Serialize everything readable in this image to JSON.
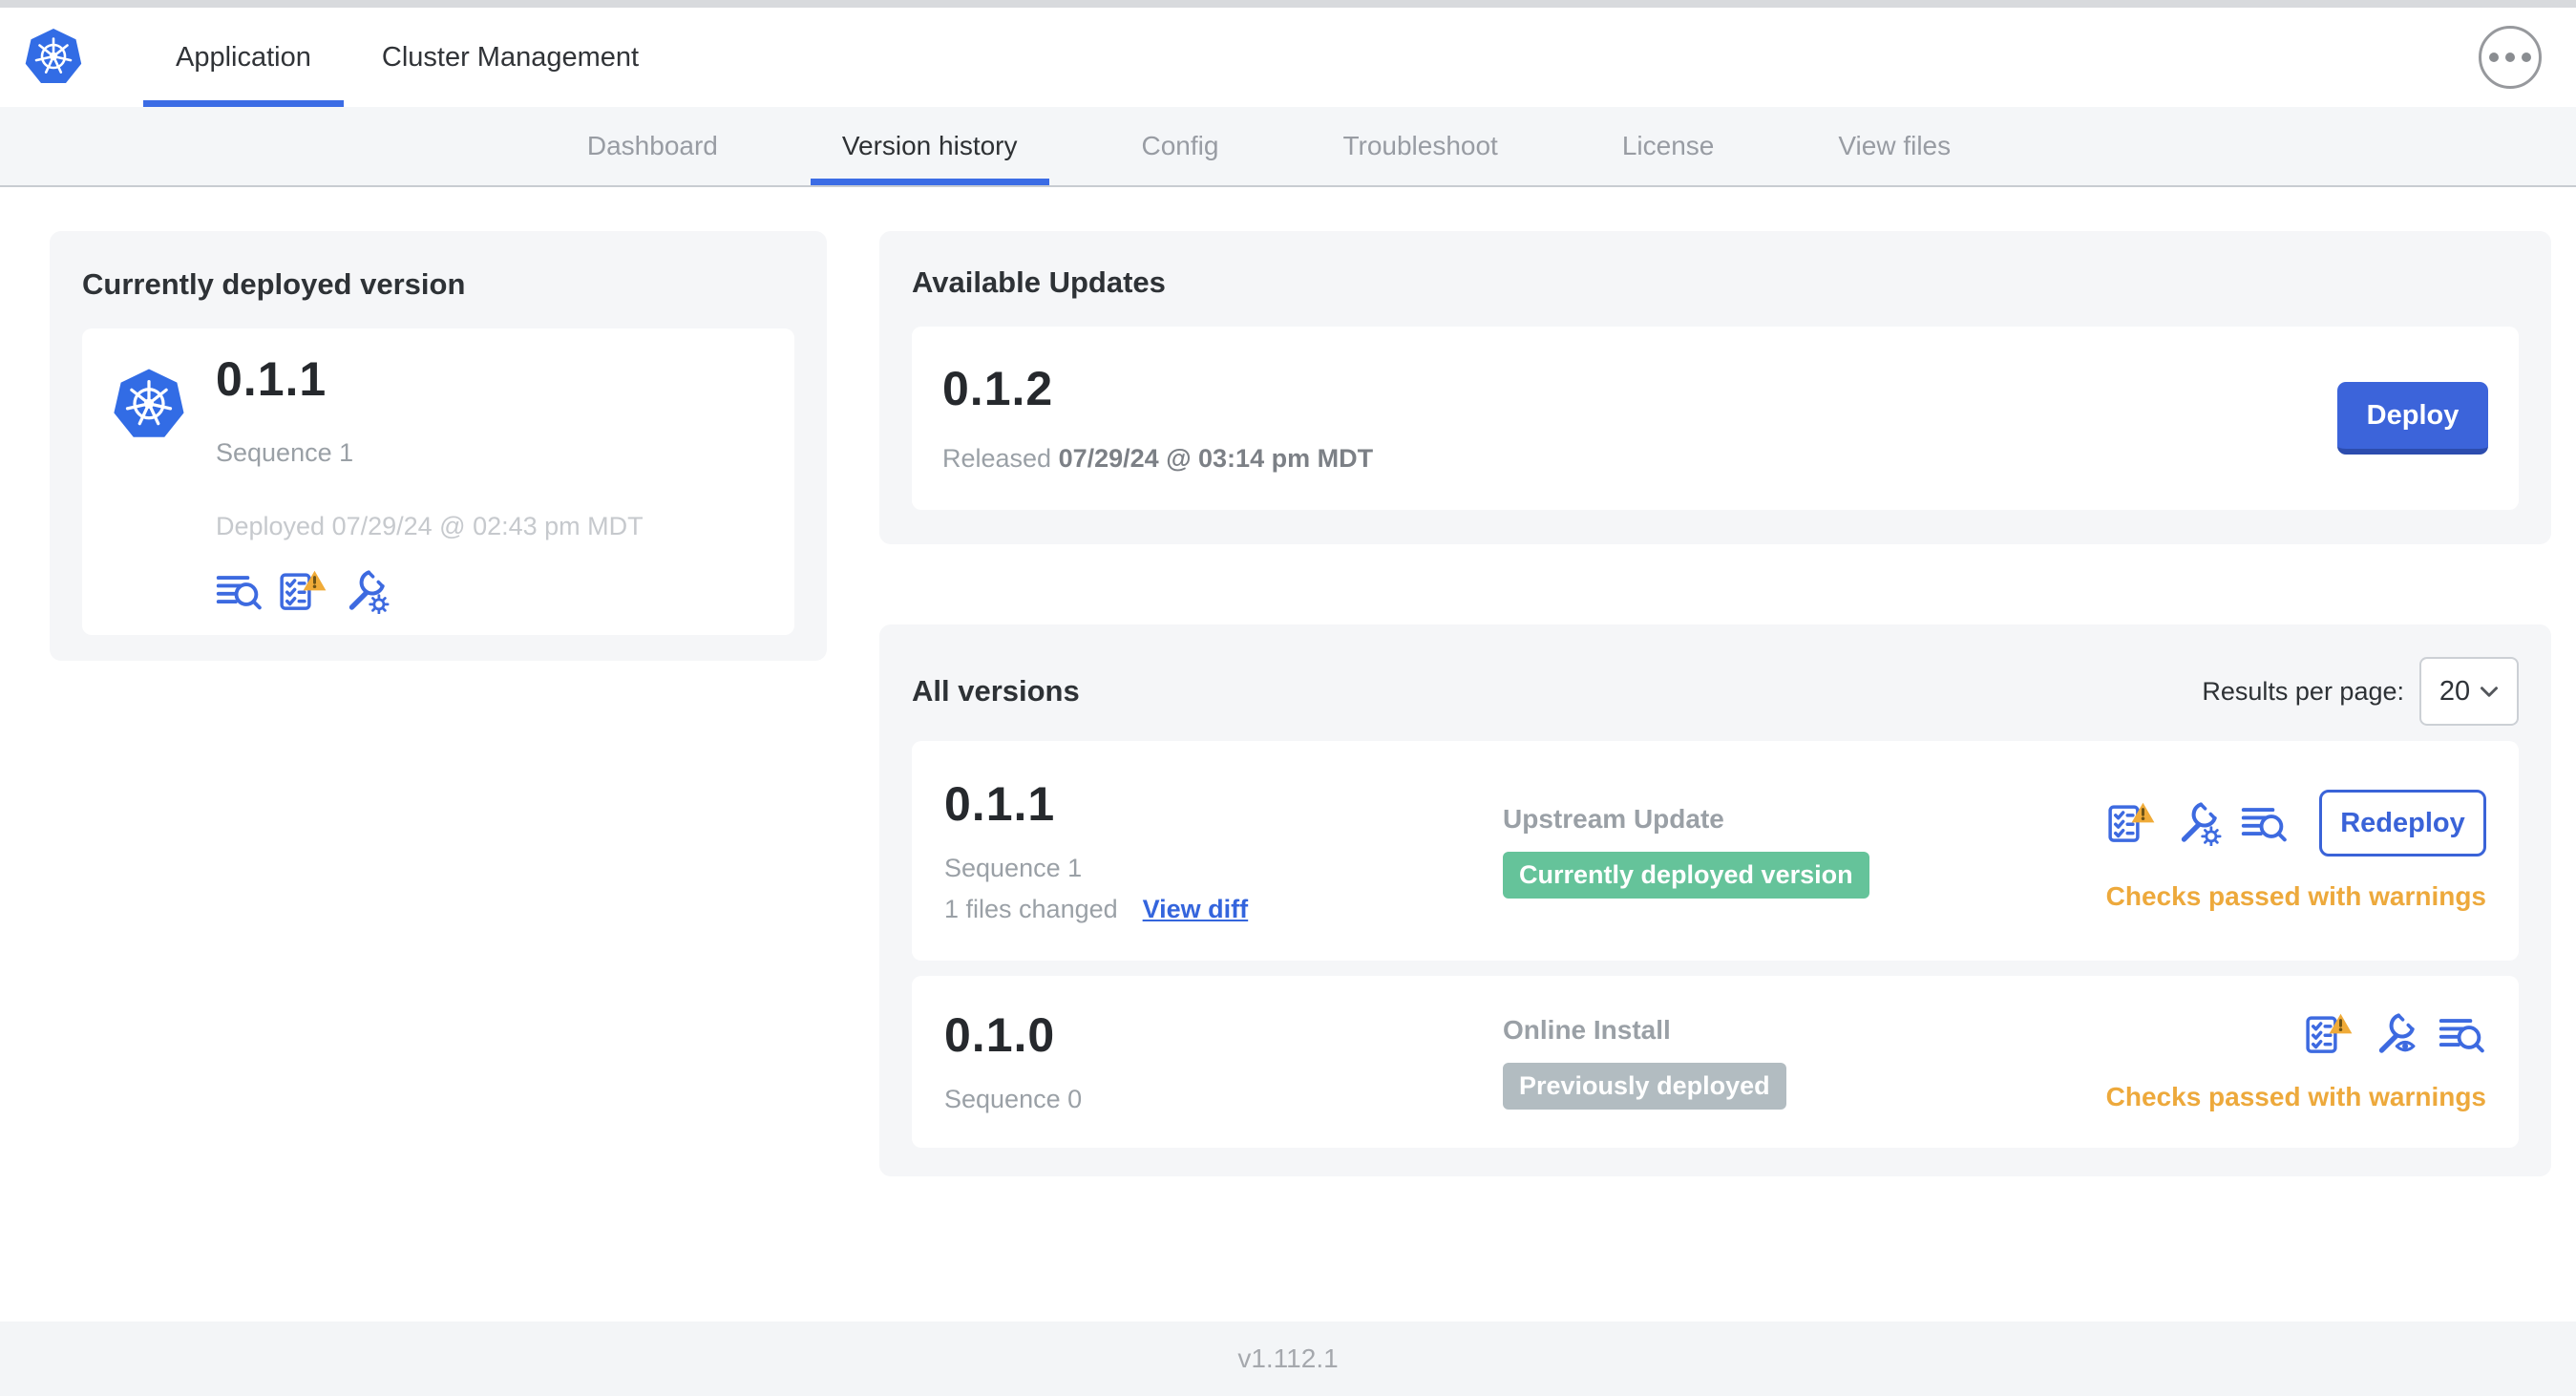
{
  "topnav": {
    "tabs": [
      {
        "label": "Application",
        "active": true
      },
      {
        "label": "Cluster Management",
        "active": false
      }
    ],
    "more_menu_icon": "ellipsis-circle-icon"
  },
  "subnav": {
    "tabs": [
      {
        "label": "Dashboard",
        "active": false
      },
      {
        "label": "Version history",
        "active": true
      },
      {
        "label": "Config",
        "active": false
      },
      {
        "label": "Troubleshoot",
        "active": false
      },
      {
        "label": "License",
        "active": false
      },
      {
        "label": "View files",
        "active": false
      }
    ]
  },
  "current_version": {
    "title": "Currently deployed version",
    "app_icon": "kubernetes-logo-icon",
    "version": "0.1.1",
    "sequence": "Sequence 1",
    "deployed": "Deployed 07/29/24 @ 02:43 pm MDT",
    "icons": [
      "logs-diff-icon",
      "preflight-checks-warning-icon",
      "config-gear-icon"
    ]
  },
  "available_updates": {
    "title": "Available Updates",
    "version": "0.1.2",
    "released_prefix": "Released ",
    "released_date": "07/29/24 @ 03:14 pm MDT",
    "deploy_label": "Deploy"
  },
  "all_versions": {
    "title": "All versions",
    "results_per_page_label": "Results per page:",
    "results_per_page_value": "20",
    "rows": [
      {
        "version": "0.1.1",
        "sequence": "Sequence 1",
        "files_changed": "1 files changed",
        "view_diff_label": "View diff",
        "source": "Upstream Update",
        "badge_label": "Currently deployed version",
        "badge_color": "#65c39a",
        "icons": [
          "preflight-checks-warning-icon",
          "config-gear-icon",
          "logs-diff-icon"
        ],
        "action_label": "Redeploy",
        "status": "Checks passed with warnings"
      },
      {
        "version": "0.1.0",
        "sequence": "Sequence 0",
        "source": "Online Install",
        "badge_label": "Previously deployed",
        "badge_color": "#b2bcc1",
        "icons": [
          "preflight-checks-warning-icon",
          "config-view-eye-icon",
          "logs-diff-icon"
        ],
        "status": "Checks passed with warnings"
      }
    ]
  },
  "footer": {
    "version": "v1.112.1"
  },
  "colors": {
    "accent_blue": "#3b6ce5",
    "kubernetes_blue": "#326CE5",
    "deploy_button": "#3c64da",
    "badge_green": "#65c39a",
    "badge_gray": "#b2bcc1",
    "warning_orange": "#eda93c",
    "link_blue": "#3465dd",
    "subnav_bg": "#f4f6f8",
    "card_bg": "#f5f6f8"
  }
}
